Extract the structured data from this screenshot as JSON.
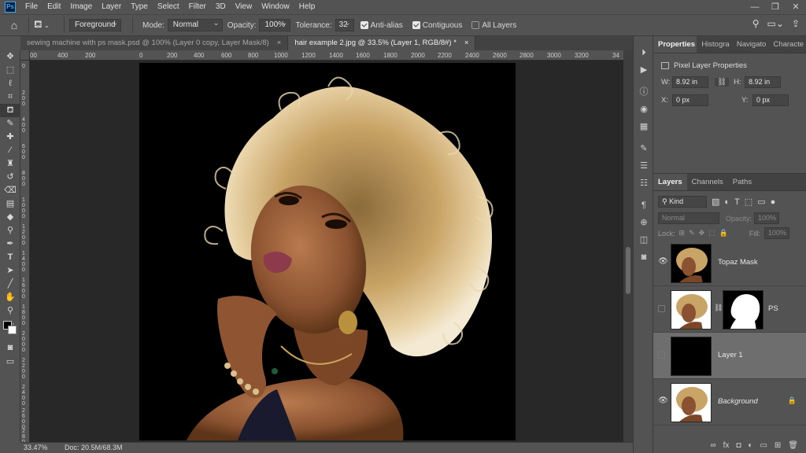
{
  "menu": [
    "File",
    "Edit",
    "Image",
    "Layer",
    "Type",
    "Select",
    "Filter",
    "3D",
    "View",
    "Window",
    "Help"
  ],
  "app_logo": "Ps",
  "window_controls": [
    "—",
    "❐",
    "✕"
  ],
  "options": {
    "fill_source": "Foreground",
    "mode_label": "Mode:",
    "mode_value": "Normal",
    "opacity_label": "Opacity:",
    "opacity_value": "100%",
    "tolerance_label": "Tolerance:",
    "tolerance_value": "32",
    "anti_alias": "Anti-alias",
    "contiguous": "Contiguous",
    "all_layers": "All Layers"
  },
  "tabs": [
    {
      "label": "sewing machine with ps mask.psd @ 100% (Layer 0 copy, Layer Mask/8)",
      "close": "×"
    },
    {
      "label": "hair example 2.jpg @ 33.5% (Layer 1, RGB/8#) *",
      "close": "×"
    }
  ],
  "ruler_h": [
    "00",
    "400",
    "200",
    "0",
    "200",
    "400",
    "600",
    "800",
    "1000",
    "1200",
    "1400",
    "1600",
    "1800",
    "2000",
    "2200",
    "2400",
    "2600",
    "2800",
    "3000",
    "3200",
    "34"
  ],
  "ruler_v": [
    "0",
    "2 0 0",
    "4 0 0",
    "6 0 0",
    "8 0 0",
    "1 0 0 0",
    "1 2 0 0",
    "1 4 0 0",
    "1 6 0 0",
    "1 8 0 0",
    "2 0 0 0",
    "2 2 0 0",
    "2 4 0 0",
    "2 6 0 0",
    "2 8 0 0"
  ],
  "status": {
    "zoom": "33.47%",
    "doc": "Doc: 20.5M/68.3M"
  },
  "properties": {
    "tabs": [
      "Properties",
      "Histogra",
      "Navigato",
      "Characte"
    ],
    "title": "Pixel Layer Properties",
    "w_label": "W:",
    "w_value": "8.92 in",
    "h_label": "H:",
    "h_value": "8.92 in",
    "x_label": "X:",
    "x_value": "0 px",
    "y_label": "Y:",
    "y_value": "0 px"
  },
  "layers": {
    "tabs": [
      "Layers",
      "Channels",
      "Paths"
    ],
    "kind": "Kind",
    "blend": "Normal",
    "opacity_label": "Opacity:",
    "opacity_value": "100%",
    "lock_label": "Lock:",
    "fill_label": "Fill:",
    "fill_value": "100%",
    "items": [
      {
        "name": "Topaz Mask"
      },
      {
        "name": "PS"
      },
      {
        "name": "Layer 1"
      },
      {
        "name": "Background"
      }
    ],
    "bottom_icons": [
      "∞",
      "fx",
      "◘",
      "◐",
      "▭",
      "⊞",
      "🗑"
    ]
  }
}
